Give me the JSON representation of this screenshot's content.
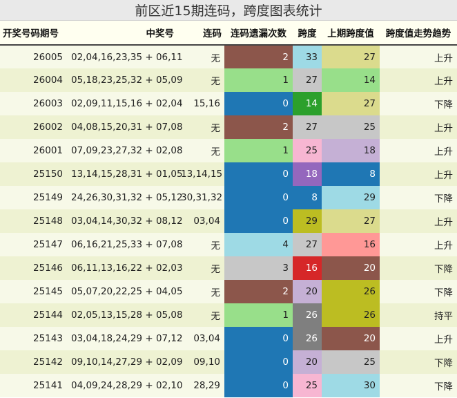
{
  "title": "前区近15期连码，跨度图表统计",
  "headers": [
    "开奖号码期号",
    "中奖号",
    "连码",
    "连码遗漏次数",
    "跨度",
    "上期跨度值",
    "跨度值走势趋势"
  ],
  "rows": [
    {
      "period": "26005",
      "numbers": "02,04,16,23,35 + 06,11",
      "consecutive": "无",
      "miss": "2",
      "span": "33",
      "prev_span": "27",
      "trend": "上升"
    },
    {
      "period": "26004",
      "numbers": "05,18,23,25,32 + 05,09",
      "consecutive": "无",
      "miss": "1",
      "span": "27",
      "prev_span": "14",
      "trend": "上升"
    },
    {
      "period": "26003",
      "numbers": "02,09,11,15,16 + 02,04",
      "consecutive": "15,16",
      "miss": "0",
      "span": "14",
      "prev_span": "27",
      "trend": "下降"
    },
    {
      "period": "26002",
      "numbers": "04,08,15,20,31 + 07,08",
      "consecutive": "无",
      "miss": "2",
      "span": "27",
      "prev_span": "25",
      "trend": "上升"
    },
    {
      "period": "26001",
      "numbers": "07,09,23,27,32 + 02,08",
      "consecutive": "无",
      "miss": "1",
      "span": "25",
      "prev_span": "18",
      "trend": "上升"
    },
    {
      "period": "25150",
      "numbers": "13,14,15,28,31 + 01,05",
      "consecutive": "13,14,15",
      "miss": "0",
      "span": "18",
      "prev_span": "8",
      "trend": "上升"
    },
    {
      "period": "25149",
      "numbers": "24,26,30,31,32 + 05,12",
      "consecutive": "30,31,32",
      "miss": "0",
      "span": "8",
      "prev_span": "29",
      "trend": "下降"
    },
    {
      "period": "25148",
      "numbers": "03,04,14,30,32 + 08,12",
      "consecutive": "03,04",
      "miss": "0",
      "span": "29",
      "prev_span": "27",
      "trend": "上升"
    },
    {
      "period": "25147",
      "numbers": "06,16,21,25,33 + 07,08",
      "consecutive": "无",
      "miss": "4",
      "span": "27",
      "prev_span": "16",
      "trend": "上升"
    },
    {
      "period": "25146",
      "numbers": "06,11,13,16,22 + 02,03",
      "consecutive": "无",
      "miss": "3",
      "span": "16",
      "prev_span": "20",
      "trend": "下降"
    },
    {
      "period": "25145",
      "numbers": "05,07,20,22,25 + 04,05",
      "consecutive": "无",
      "miss": "2",
      "span": "20",
      "prev_span": "26",
      "trend": "下降"
    },
    {
      "period": "25144",
      "numbers": "02,05,13,15,28 + 05,08",
      "consecutive": "无",
      "miss": "1",
      "span": "26",
      "prev_span": "26",
      "trend": "持平"
    },
    {
      "period": "25143",
      "numbers": "03,04,18,24,29 + 07,12",
      "consecutive": "03,04",
      "miss": "0",
      "span": "26",
      "prev_span": "20",
      "trend": "上升"
    },
    {
      "period": "25142",
      "numbers": "09,10,14,27,29 + 02,09",
      "consecutive": "09,10",
      "miss": "0",
      "span": "20",
      "prev_span": "25",
      "trend": "下降"
    },
    {
      "period": "25141",
      "numbers": "04,09,24,28,29 + 02,10",
      "consecutive": "28,29",
      "miss": "0",
      "span": "25",
      "prev_span": "30",
      "trend": "下降"
    }
  ],
  "value_colors": {
    "miss": {
      "0": "#1f77b4",
      "1": "#98df8a",
      "2": "#8c564b",
      "3": "#c7c7c7",
      "4": "#9edae5"
    },
    "span": {
      "8": "#1f77b4",
      "14": "#2ca02c",
      "16": "#d62728",
      "18": "#9467bd",
      "20": "#c5b0d5",
      "25": "#f7b6d2",
      "26": "#7f7f7f",
      "27": "#c7c7c7",
      "29": "#bcbd22",
      "33": "#9edae5"
    },
    "prev_span": {
      "8": "#1f77b4",
      "14": "#98df8a",
      "16": "#ff9896",
      "18": "#c5b0d5",
      "20": "#8c564b",
      "25": "#c7c7c7",
      "26": "#bcbd22",
      "27": "#dbdb8d",
      "29": "#9edae5",
      "30": "#9edae5"
    }
  },
  "light_text_colors": [
    "#1f77b4",
    "#2ca02c",
    "#d62728",
    "#9467bd",
    "#8c564b",
    "#7f7f7f"
  ]
}
